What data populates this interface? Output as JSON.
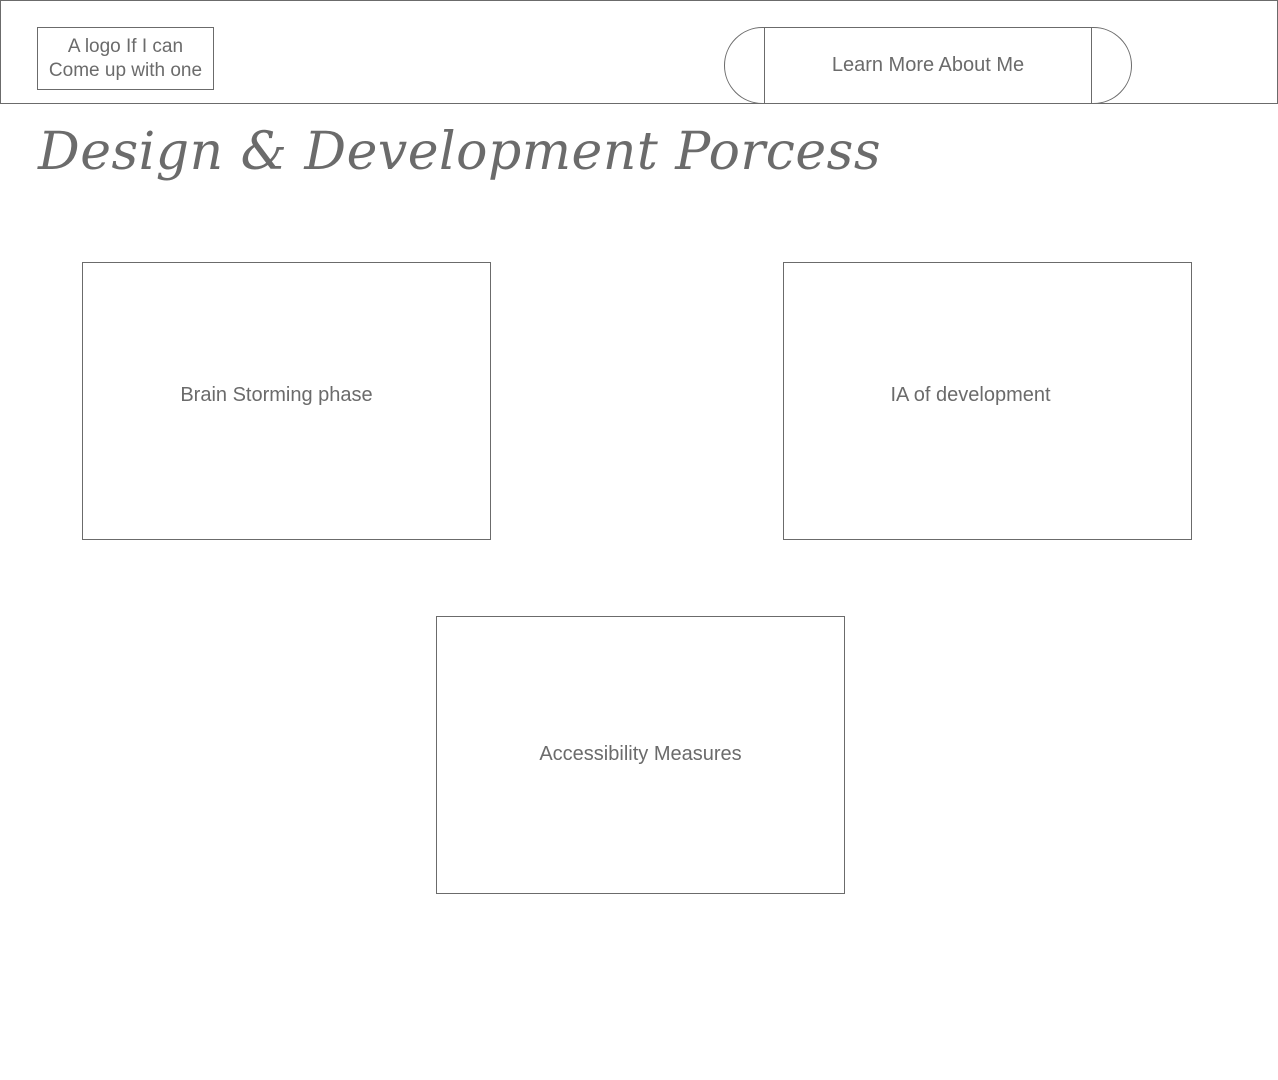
{
  "header": {
    "logo_text": "A logo If I can\nCome up with one",
    "learn_more_label": "Learn More About Me"
  },
  "main": {
    "title": "Design & Development Porcess",
    "cards": [
      {
        "label": "Brain Storming phase"
      },
      {
        "label": "IA of development"
      },
      {
        "label": "Accessibility Measures"
      }
    ]
  }
}
